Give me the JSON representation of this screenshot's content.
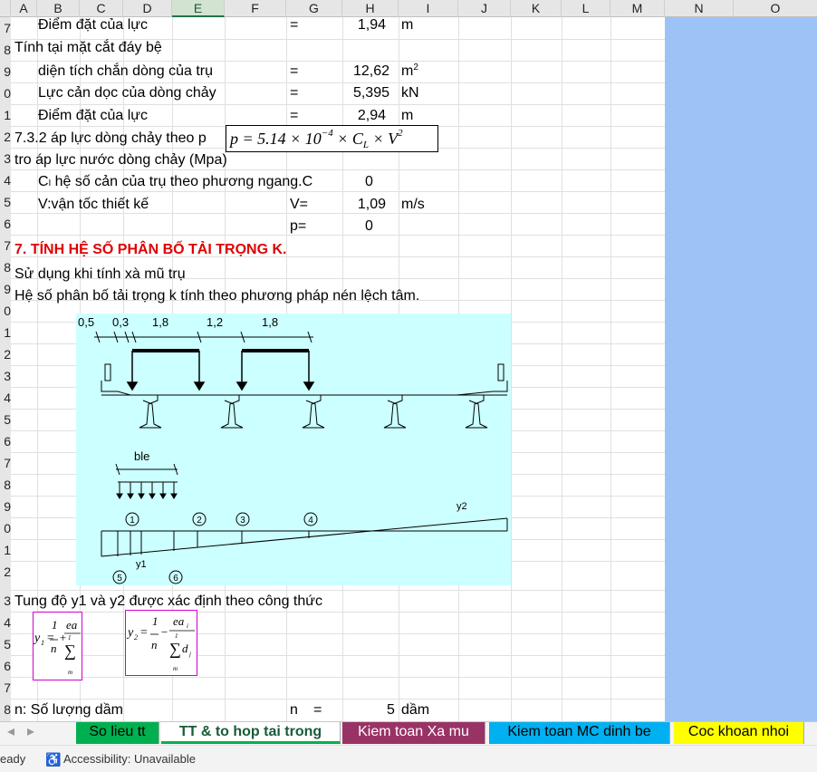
{
  "columns": [
    "A",
    "B",
    "C",
    "D",
    "E",
    "F",
    "G",
    "H",
    "I",
    "J",
    "K",
    "L",
    "M",
    "N",
    "O"
  ],
  "selected_column": "E",
  "row_labels": [
    "7",
    "8",
    "9",
    "0",
    "1",
    "2",
    "3",
    "4",
    "5",
    "6",
    "7",
    "8",
    "9",
    "0",
    "1",
    "2",
    "3",
    "4",
    "5",
    "6",
    "7",
    "8",
    "9",
    "0",
    "1",
    "2",
    "3",
    "4",
    "5",
    "6",
    "7",
    "8"
  ],
  "rows": {
    "r7": {
      "label": "Điểm đặt của lực",
      "eq": "=",
      "val": "1,94",
      "unit": "m"
    },
    "r8": {
      "label": "Tính tại mặt cắt đáy bệ"
    },
    "r9": {
      "label": "diện tích chắn dòng của trụ",
      "eq": "=",
      "val": "12,62",
      "unit": "m",
      "unit_sup": "2"
    },
    "r10": {
      "label": "Lực cản dọc của dòng chảy",
      "eq": "=",
      "val": "5,395",
      "unit": "kN"
    },
    "r11": {
      "label": "Điểm đặt của lực",
      "eq": "=",
      "val": "2,94",
      "unit": "m"
    },
    "r12": {
      "label": "7.3.2 áp lực dòng chảy theo p"
    },
    "r13": {
      "label": "tro áp lực nước dòng chảy (Mpa)"
    },
    "r14": {
      "label": "Cₗ hệ số cản của trụ theo phương ngang.C",
      "val": "0"
    },
    "r15": {
      "label": "V:vận tốc thiết kế",
      "eq": "V=",
      "val": "1,09",
      "unit": "m/s"
    },
    "r16": {
      "eq": "p=",
      "val": "0"
    },
    "r17": {
      "label": "7. TÍNH HỆ SỐ PHÂN BỐ TẢI TRỌNG K."
    },
    "r18": {
      "label": "Sử dụng khi tính xà mũ trụ"
    },
    "r19": {
      "label": "Hệ số phân bố tải trọng k tính theo phương pháp nén lệch tâm."
    },
    "r33": {
      "label": "Tung độ y1 và y2 được xác định theo công thức"
    },
    "r38": {
      "label": "n: Số lượng dầm",
      "eq": "n",
      "eq2": "=",
      "val": "5",
      "unit": "dầm"
    }
  },
  "formula": {
    "prefix": "p = 5.14 × 10",
    "exp": "−4",
    "mid": " × C",
    "sub": "L",
    "tail": " × V",
    "exp2": "2"
  },
  "diagram": {
    "dims": [
      "0,5",
      "0,3",
      "1,8",
      "1,2",
      "1,8"
    ],
    "ble": "ble",
    "y1": "y1",
    "y2": "y2",
    "circles": [
      "1",
      "2",
      "3",
      "4",
      "5",
      "6"
    ]
  },
  "equations": {
    "y1": {
      "lhs": "y",
      "lhs_sub": "1",
      "n": "n",
      "num": "ea",
      "frac_num": "1",
      "sum_top": "1",
      "sum_bot": "m"
    },
    "y2": {
      "lhs": "y",
      "lhs_sub": "2",
      "n": "n",
      "num": "ea",
      "num_sub": "i",
      "frac_num": "1",
      "sum_top": "1",
      "sum_bot": "m",
      "d": "d",
      "d_sub": "j"
    }
  },
  "tabs": [
    {
      "label": "So lieu tt",
      "color": "#00b050",
      "text_color": "#000000"
    },
    {
      "label": "TT & to hop tai trong",
      "color": "#00b050",
      "text_color": "#185c37",
      "active": true
    },
    {
      "label": "Kiem toan Xa mu",
      "color": "#993366",
      "text_color": "#ffffff"
    },
    {
      "label": "Kiem toan MC dinh be",
      "color": "#00b0f0",
      "text_color": "#000000"
    },
    {
      "label": "Coc khoan nhoi",
      "color": "#ffff00",
      "text_color": "#000000"
    }
  ],
  "status": {
    "ready": "eady",
    "accessibility": "Accessibility: Unavailable"
  }
}
